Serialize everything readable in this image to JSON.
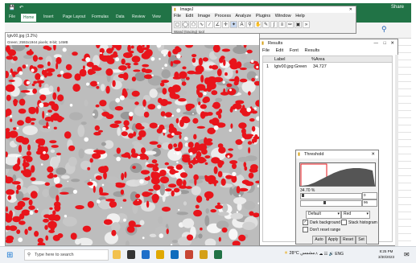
{
  "excel": {
    "ribbon_tabs": [
      "File",
      "Home",
      "Insert",
      "Page Layout",
      "Formulas",
      "Data",
      "Review",
      "View"
    ],
    "active_tab": "Home",
    "share_label": "Share"
  },
  "image_window": {
    "title": "lgtv00.jpg (3.2%)",
    "info": "Green; 2592x1944 pixels; 8-bit; 14MB"
  },
  "imagej": {
    "title": "ImageJ",
    "menu": [
      "File",
      "Edit",
      "Image",
      "Process",
      "Analyze",
      "Plugins",
      "Window",
      "Help"
    ],
    "status": "Wand (tracing) tool"
  },
  "results": {
    "title": "Results",
    "menu": [
      "File",
      "Edit",
      "Font",
      "Results"
    ],
    "columns": [
      "",
      "Label",
      "%Area"
    ],
    "rows": [
      {
        "index": "1",
        "label": "lgtv00.jpg:Green",
        "area": "34.727"
      }
    ]
  },
  "threshold": {
    "title": "Threshold",
    "percent": "34.70 %",
    "min_value": "0",
    "max_value": "96",
    "method": "Default",
    "mode": "Red",
    "dark_background": "Dark background",
    "stack_histogram": "Stack histogram",
    "dont_reset": "Don't reset range",
    "buttons": [
      "Auto",
      "Apply",
      "Reset",
      "Set"
    ],
    "colors": {
      "overlay": "#e8141b"
    }
  },
  "taskbar": {
    "search_placeholder": "Type here to search",
    "weather": "28°C",
    "weather_desc": "مشمس",
    "lang": "ENG",
    "time": "8:25 PM",
    "date": "3/30/2023"
  }
}
